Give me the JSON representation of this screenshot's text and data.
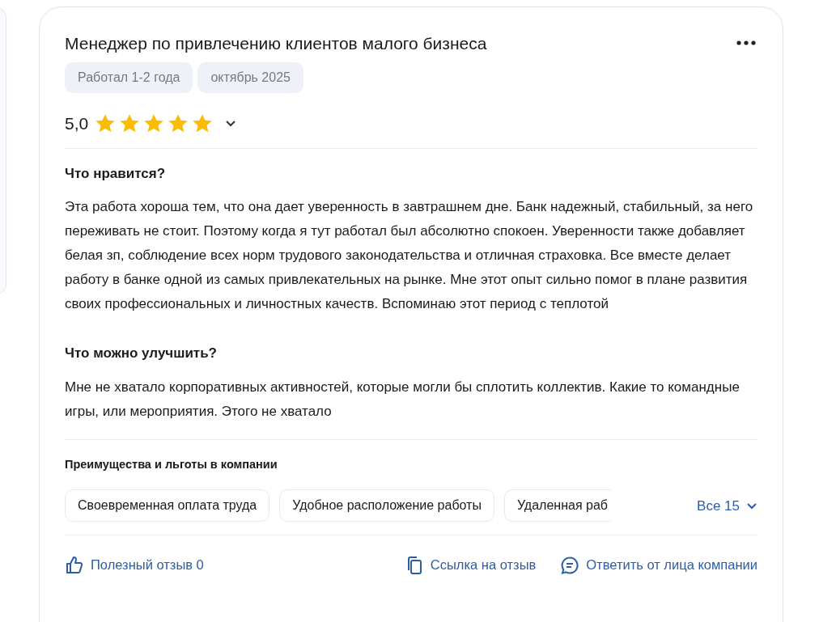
{
  "review": {
    "title": "Менеджер по привлечению клиентов малого бизнеса",
    "tags": [
      "Работал 1-2 года",
      "октябрь 2025"
    ],
    "rating": {
      "value": "5,0",
      "stars": 5
    },
    "sections": [
      {
        "heading": "Что нравится?",
        "text": "Эта работа хороша тем, что она дает уверенность в завтрашнем дне. Банк надежный, стабильный, за него переживать не стоит. Поэтому когда я тут работал был абсолютно спокоен. Уверенности также добавляет белая зп, соблюдение всех норм трудового законодательства и отличная страховка. Все вместе делает работу в банке одной из самых привлекательных на рынке. Мне этот опыт сильно помог в плане развития своих профессиональных и личностных качеств. Вспоминаю этот период с теплотой"
      },
      {
        "heading": "Что можно улучшить?",
        "text": "Мне не хватало корпоративных активностей, которые могли бы сплотить коллектив. Какие то командные игры, или мероприятия. Этого не хватало"
      }
    ],
    "benefits": {
      "heading": "Преимущества и льготы в компании",
      "chips": [
        "Своевременная оплата труда",
        "Удобное расположение работы",
        "Удаленная раб"
      ],
      "more": "Все 15"
    },
    "actions": [
      {
        "kind": "like",
        "label": "Полезный отзыв 0"
      },
      {
        "kind": "link",
        "label": "Ссылка на отзыв"
      },
      {
        "kind": "reply",
        "label": "Ответить от лица компании"
      }
    ]
  }
}
